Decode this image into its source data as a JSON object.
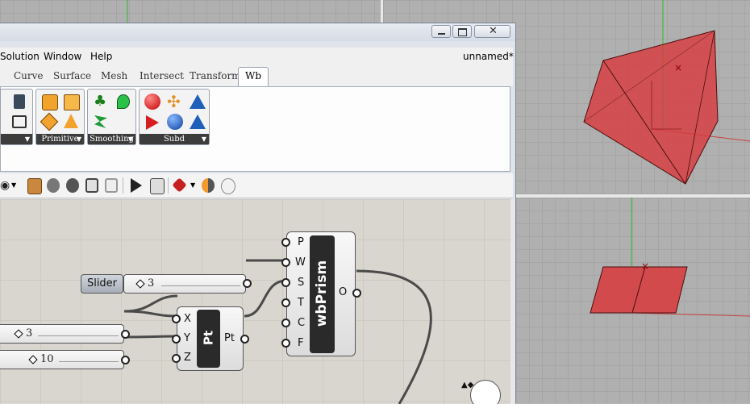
{
  "menu": [
    "Solution",
    "Window",
    "Help"
  ],
  "document_title": "unnamed*",
  "tabs": [
    "Curve",
    "Surface",
    "Mesh",
    "Intersect",
    "Transform"
  ],
  "active_tab": "Wb",
  "ribbon_groups": [
    "Primitive",
    "Smoothing",
    "Subd"
  ],
  "canvas": {
    "slider_label": "Slider",
    "slider_main_value": "3",
    "slider_x_value": "3",
    "slider_y_value": "10",
    "pt_component": {
      "title": "Pt",
      "inputs": [
        "X",
        "Y",
        "Z"
      ],
      "output": "Pt"
    },
    "prism_component": {
      "title": "wbPrism",
      "inputs": [
        "P",
        "W",
        "S",
        "T",
        "C",
        "F"
      ],
      "output": "O"
    }
  },
  "colors": {
    "prism_fill": "#d9383c",
    "canvas": "#d9d6cf",
    "viewport": "#b0b0b0"
  }
}
